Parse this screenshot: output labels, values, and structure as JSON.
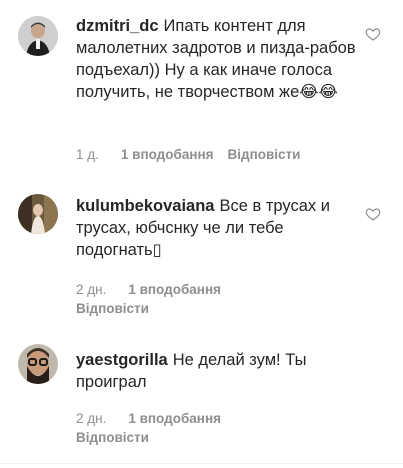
{
  "comments": [
    {
      "username": "dzmitri_dc",
      "text": "Ипать контент для малолетних задротов и пизда-рабов подъехал)) Ну а как иначе голоса получить, не творчеством же😂😂",
      "age": "1 д.",
      "likes": "1 вподобання",
      "reply": "Відповісти"
    },
    {
      "username": "kulumbekovaiana",
      "text": "Все в трусах и трусах, юбчснку че ли тебе подогнать▯",
      "age": "2 дн.",
      "likes": "1 вподобання",
      "reply": "Відповісти"
    },
    {
      "username": "yaestgorilla",
      "text": "Не делай зум! Ты проиграл",
      "age": "2 дн.",
      "likes": "1 вподобання",
      "reply": "Відповісти"
    }
  ],
  "colors": {
    "text": "#262626",
    "muted": "#8e8e8e",
    "divider": "#efefef"
  },
  "icons": {
    "like": "heart-outline-icon"
  }
}
